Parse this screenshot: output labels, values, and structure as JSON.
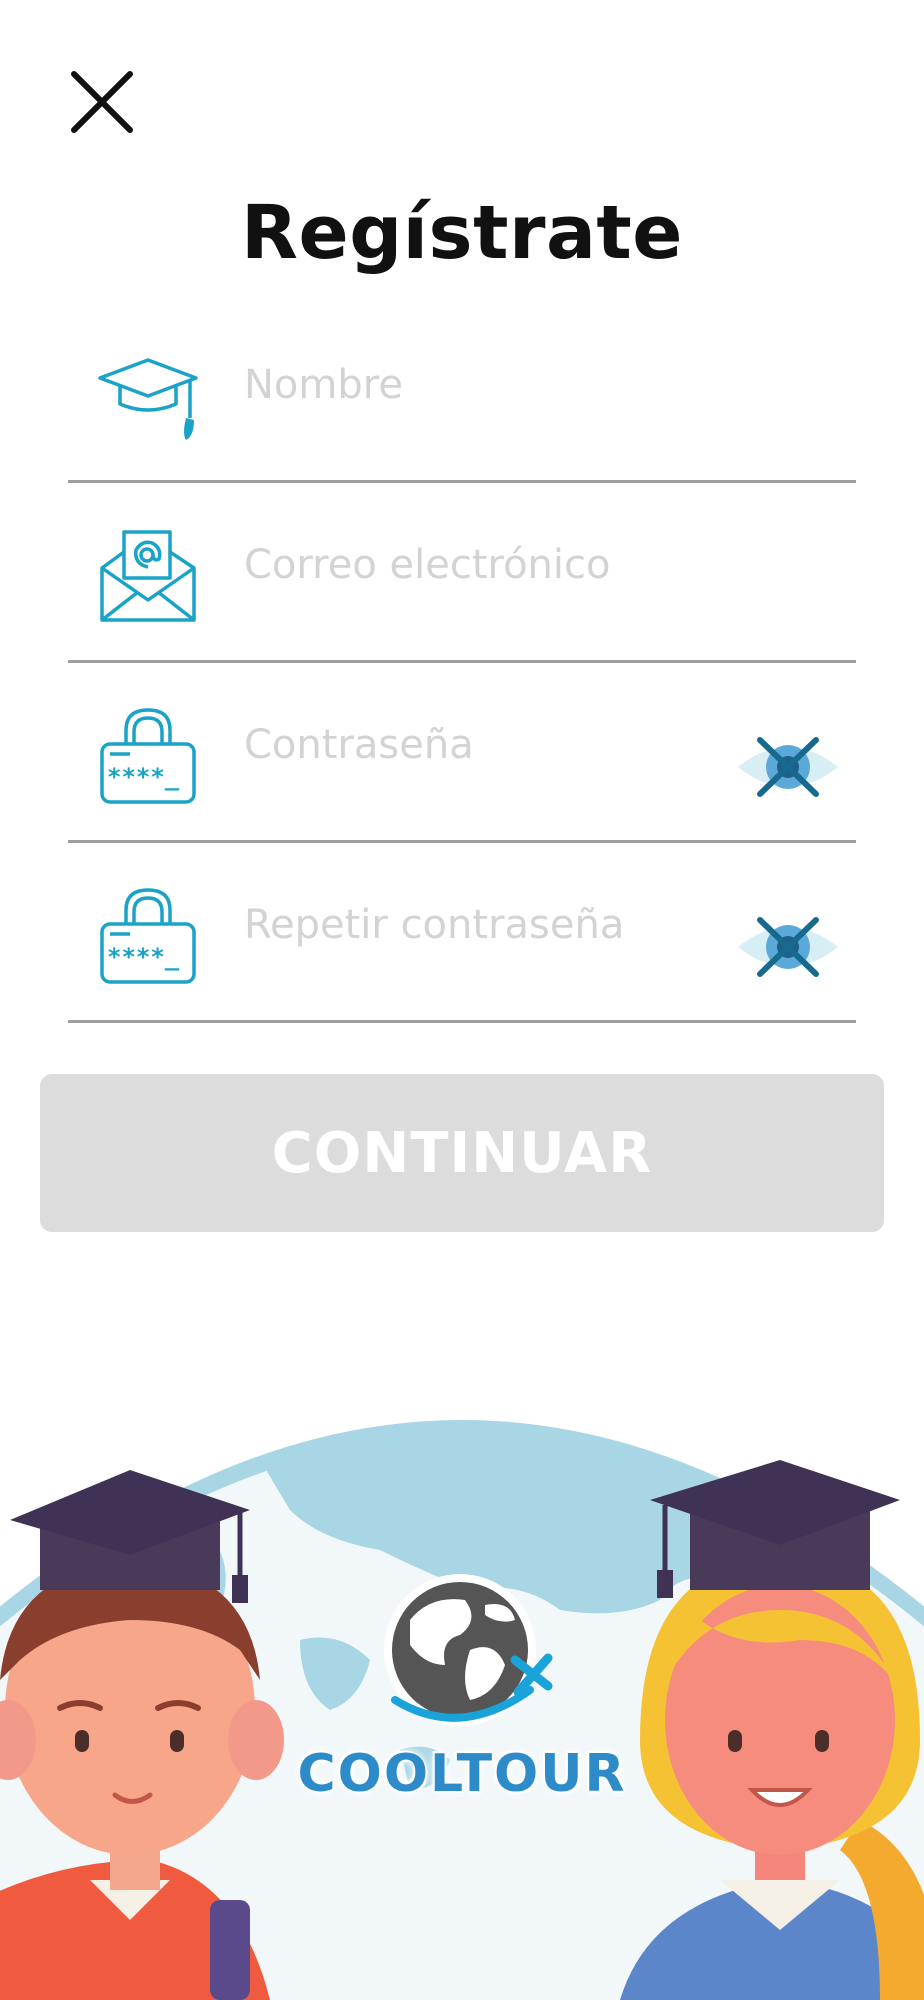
{
  "header": {
    "title": "Regístrate"
  },
  "form": {
    "name": {
      "placeholder": "Nombre",
      "icon": "graduation-cap-icon"
    },
    "email": {
      "placeholder": "Correo electrónico",
      "icon": "envelope-at-icon"
    },
    "password": {
      "placeholder": "Contraseña",
      "icon": "padlock-password-icon",
      "toggle_icon": "eye-hidden-icon"
    },
    "repeat_password": {
      "placeholder": "Repetir contraseña",
      "icon": "padlock-password-icon",
      "toggle_icon": "eye-hidden-icon"
    }
  },
  "continue_label": "CONTINUAR",
  "brand": {
    "name": "COOLTOUR"
  },
  "colors": {
    "accent": "#1aa3c8",
    "button_disabled": "#dcdcdc",
    "placeholder": "#d3d3d3",
    "brand_text": "#2e8bc9"
  }
}
